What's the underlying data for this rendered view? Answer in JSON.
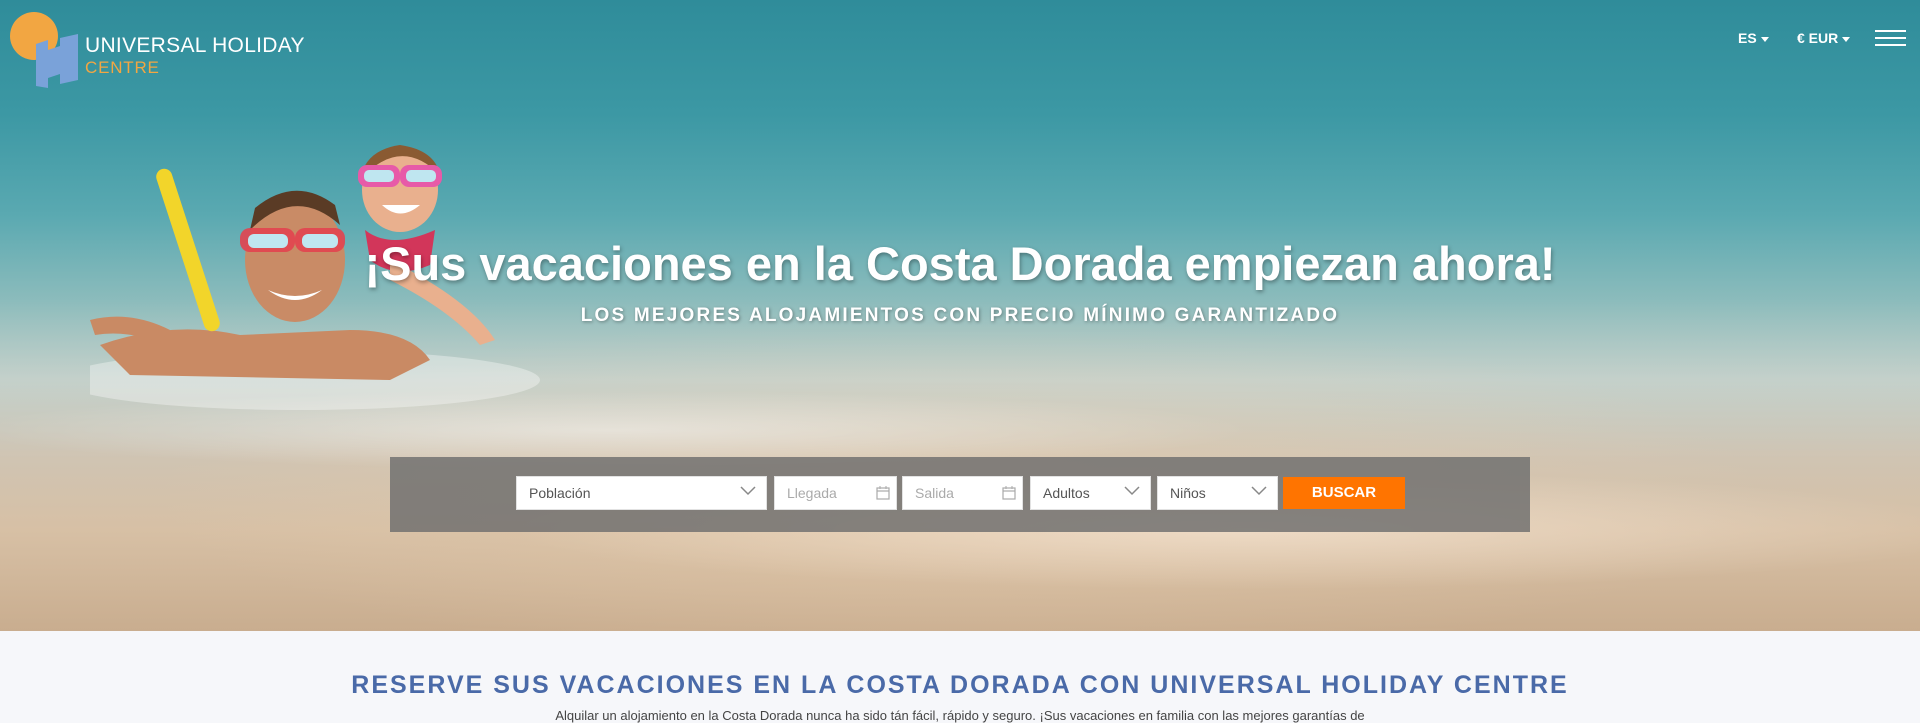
{
  "header": {
    "logo_line1": "UNIVERSAL HOLIDAY",
    "logo_line2": "CENTRE",
    "language": "ES",
    "currency": "€ EUR"
  },
  "hero": {
    "headline": "¡Sus vacaciones en la Costa Dorada empiezan ahora!",
    "subheadline": "LOS MEJORES ALOJAMIENTOS CON PRECIO MÍNIMO GARANTIZADO"
  },
  "search": {
    "poblacion": "Población",
    "llegada_placeholder": "Llegada",
    "salida_placeholder": "Salida",
    "adultos": "Adultos",
    "ninos": "Niños",
    "button_label": "BUSCAR"
  },
  "intro": {
    "title": "RESERVE SUS VACACIONES EN LA COSTA DORADA CON UNIVERSAL HOLIDAY CENTRE",
    "text": "Alquilar un alojamiento en la Costa Dorada nunca ha sido tán fácil, rápido y seguro. ¡Sus vacaciones en familia con las mejores garantías de"
  },
  "colors": {
    "accent_orange": "#ff7400",
    "logo_orange": "#f2a642",
    "logo_blue": "#7aa2d9",
    "title_blue": "#4a6aa8"
  }
}
